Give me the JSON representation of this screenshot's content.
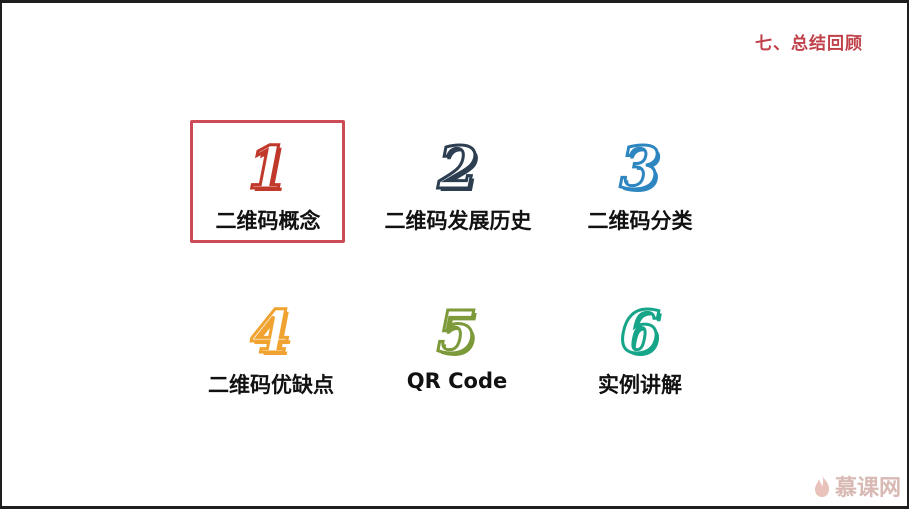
{
  "slide": {
    "section_title": "七、总结回顾",
    "items": [
      {
        "number": "1",
        "label": "二维码概念",
        "color": "#c0392b",
        "selected": true
      },
      {
        "number": "2",
        "label": "二维码发展历史",
        "color": "#2c3e50",
        "selected": false
      },
      {
        "number": "3",
        "label": "二维码分类",
        "color": "#2e86c1",
        "selected": false
      },
      {
        "number": "4",
        "label": "二维码优缺点",
        "color": "#f0a330",
        "selected": false
      },
      {
        "number": "5",
        "label": "QR Code",
        "color": "#7d9a3a",
        "selected": false
      },
      {
        "number": "6",
        "label": "实例讲解",
        "color": "#17a589",
        "selected": false
      }
    ],
    "watermark": {
      "text": "慕课网",
      "icon": "flame-icon"
    }
  }
}
